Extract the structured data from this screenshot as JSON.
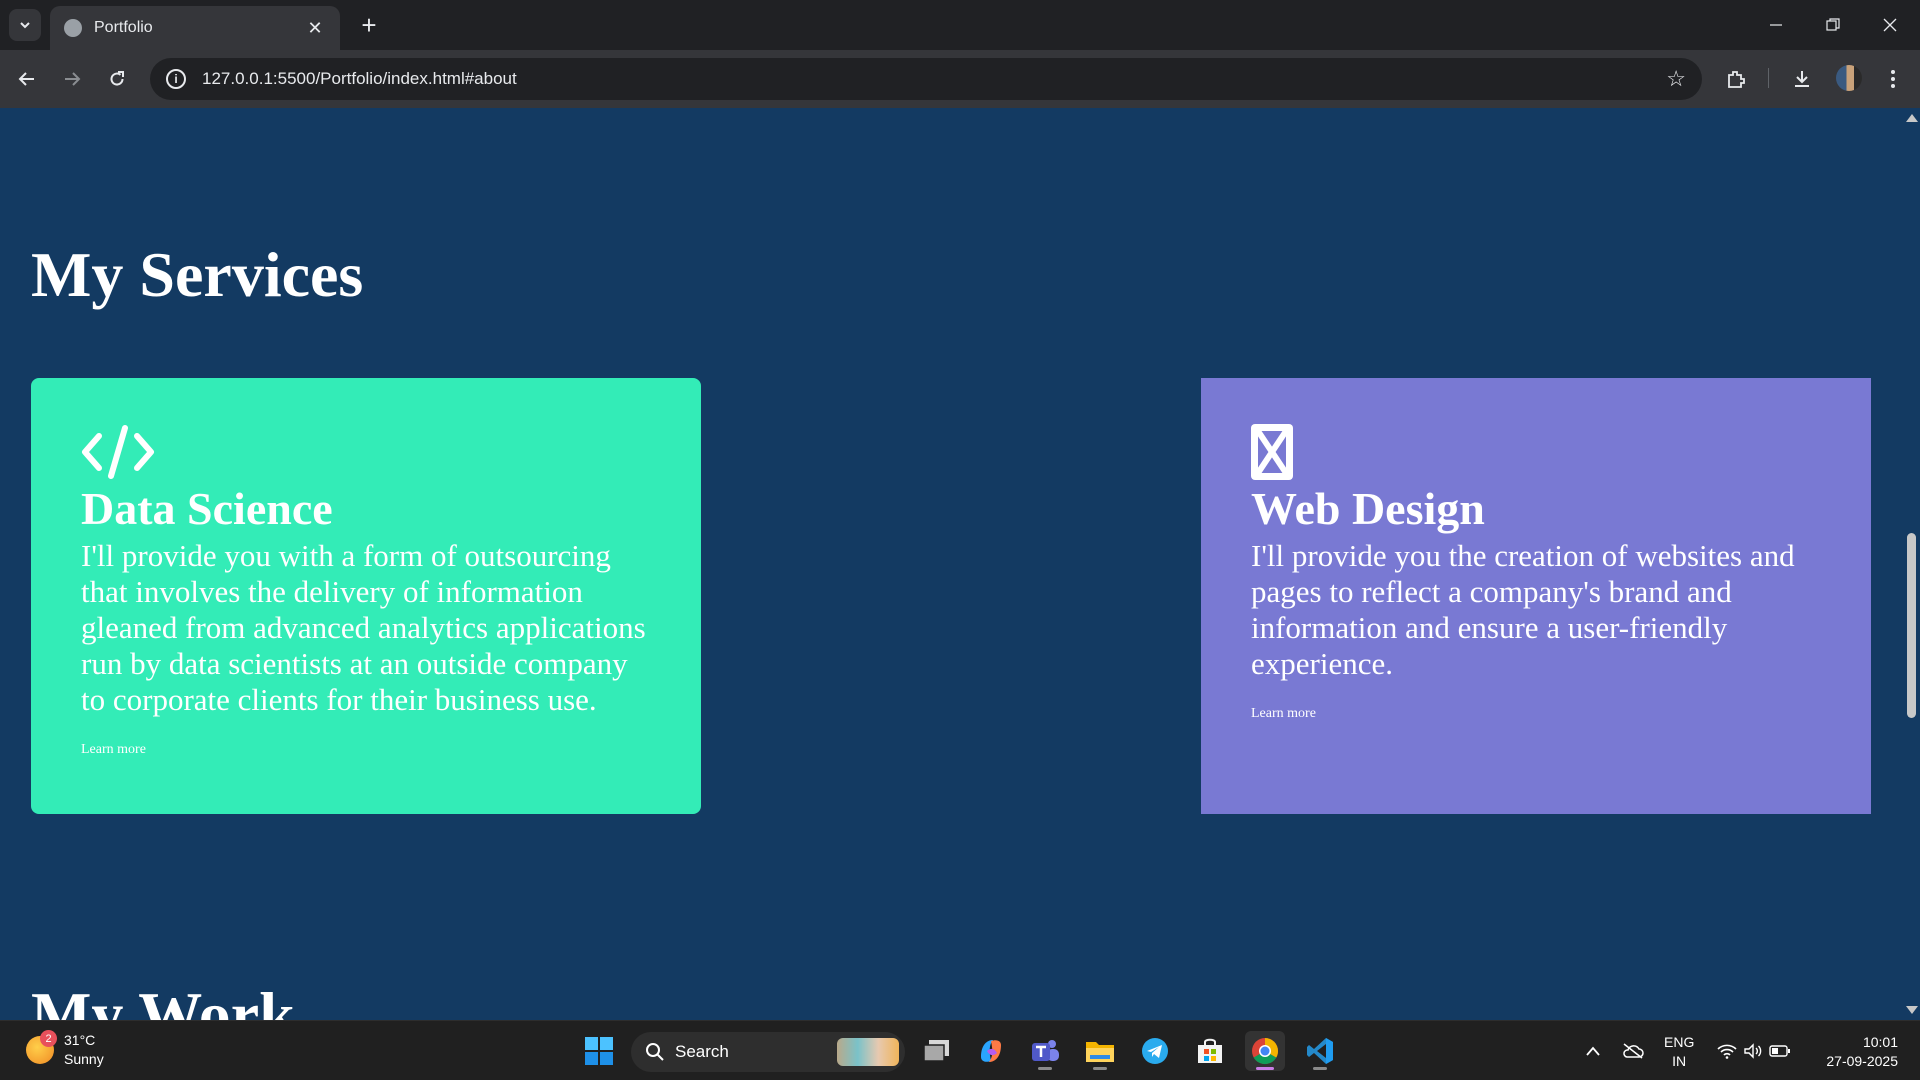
{
  "browser": {
    "tab_title": "Portfolio",
    "url": "127.0.0.1:5500/Portfolio/index.html#about"
  },
  "page": {
    "heading": "My Services",
    "cards": [
      {
        "title": "Data Science",
        "icon": "code-icon",
        "description": "I'll provide you with a form of outsourcing that involves the delivery of information gleaned from advanced analytics applications run by data scientists at an outside company to corporate clients for their business use.",
        "link": "Learn more",
        "background": "#33ecb7"
      },
      {
        "title": "Web Design",
        "icon": "crop-icon",
        "description": "I'll provide you the creation of websites and pages to reflect a company's brand and information and ensure a user-friendly experience.",
        "link": "Learn more",
        "background": "#7979d3"
      }
    ],
    "next_heading": "My Work",
    "background": "#133a62"
  },
  "taskbar": {
    "weather_temp": "31°C",
    "weather_desc": "Sunny",
    "weather_badge": "2",
    "search_label": "Search",
    "lang_line1": "ENG",
    "lang_line2": "IN",
    "time": "10:01",
    "date": "27-09-2025"
  }
}
